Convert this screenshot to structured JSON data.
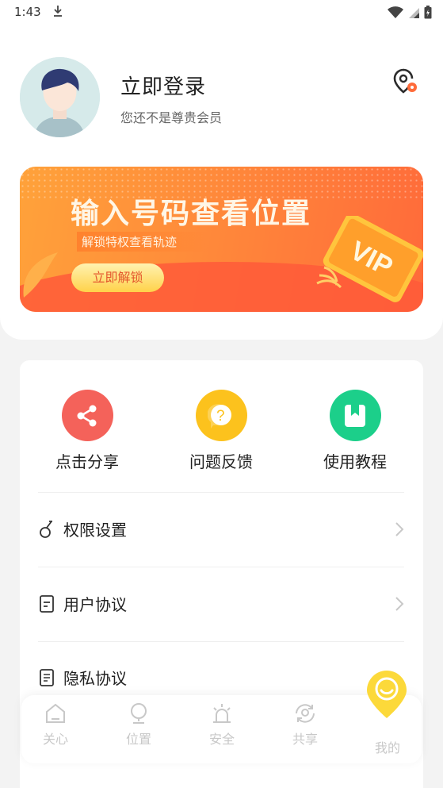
{
  "status_bar": {
    "time": "1:43",
    "icons": [
      "download-icon",
      "wifi-icon",
      "signal-icon",
      "battery-icon"
    ]
  },
  "profile": {
    "login_label": "立即登录",
    "member_status": "您还不是尊贵会员"
  },
  "banner": {
    "title": "输入号码查看位置",
    "subtitle": "解锁特权查看轨迹",
    "button_label": "立即解锁",
    "badge": "VIP"
  },
  "shortcuts": [
    {
      "label": "点击分享",
      "icon": "share-icon",
      "color": "#f4625a"
    },
    {
      "label": "问题反馈",
      "icon": "question-icon",
      "color": "#fcc21d"
    },
    {
      "label": "使用教程",
      "icon": "book-icon",
      "color": "#1ccf8a"
    }
  ],
  "menu": [
    {
      "label": "权限设置",
      "icon": "permission-icon"
    },
    {
      "label": "用户协议",
      "icon": "agreement-icon"
    },
    {
      "label": "隐私协议",
      "icon": "privacy-icon"
    }
  ],
  "bottom_nav": [
    {
      "label": "关心",
      "icon": "home-icon"
    },
    {
      "label": "位置",
      "icon": "location-pin-icon"
    },
    {
      "label": "安全",
      "icon": "alarm-icon"
    },
    {
      "label": "共享",
      "icon": "share-location-icon"
    },
    {
      "label": "我的",
      "icon": "profile-icon",
      "active": true
    }
  ],
  "colors": {
    "accent_yellow": "#fcd93a",
    "banner_orange": "#ff8a3a",
    "nav_inactive": "#c8c8c8"
  }
}
